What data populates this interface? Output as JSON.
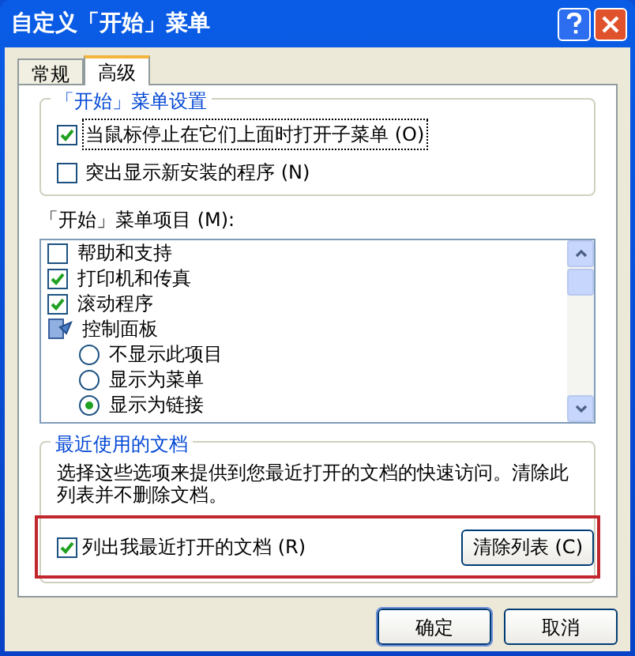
{
  "window": {
    "title": "自定义「开始」菜单"
  },
  "tabs": [
    {
      "label": "常规",
      "selected": false
    },
    {
      "label": "高级",
      "selected": true
    }
  ],
  "start_menu_settings": {
    "title": "「开始」菜单设置",
    "options": [
      {
        "label": "当鼠标停止在它们上面时打开子菜单 (O)",
        "checked": true
      },
      {
        "label": "突出显示新安装的程序 (N)",
        "checked": false
      }
    ]
  },
  "start_menu_items": {
    "label": "「开始」菜单项目 (M):",
    "items": [
      {
        "kind": "checkbox",
        "label": "帮助和支持",
        "checked": false
      },
      {
        "kind": "checkbox",
        "label": "打印机和传真",
        "checked": true
      },
      {
        "kind": "checkbox",
        "label": "滚动程序",
        "checked": true
      },
      {
        "kind": "group",
        "label": "控制面板",
        "children": [
          {
            "kind": "radio",
            "label": "不显示此项目",
            "selected": false
          },
          {
            "kind": "radio",
            "label": "显示为菜单",
            "selected": false
          },
          {
            "kind": "radio",
            "label": "显示为链接",
            "selected": true
          }
        ]
      }
    ]
  },
  "recent_documents": {
    "title": "最近使用的文档",
    "description": "选择这些选项来提供到您最近打开的文档的快速访问。清除此列表并不删除文档。",
    "option": {
      "label": "列出我最近打开的文档 (R)",
      "checked": true
    },
    "clear_button": "清除列表 (C)"
  },
  "buttons": [
    "确定",
    "取消"
  ]
}
